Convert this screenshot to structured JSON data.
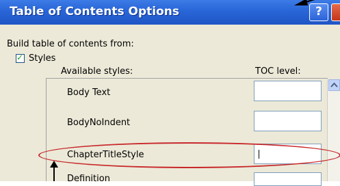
{
  "dialog": {
    "title": "Table of Contents Options",
    "help_glyph": "?"
  },
  "build": {
    "label": "Build table of contents from:",
    "styles_checkbox": {
      "label": "Styles",
      "checked": true,
      "check_glyph": "✓"
    }
  },
  "columns": {
    "available_styles": "Available styles:",
    "toc_level": "TOC level:"
  },
  "styles": [
    {
      "name": "Body Text",
      "level": ""
    },
    {
      "name": "BodyNoIndent",
      "level": ""
    },
    {
      "name": "ChapterTitleStyle",
      "level": ""
    },
    {
      "name": "Definition",
      "level": ""
    }
  ],
  "colors": {
    "titlebar": "#2a67d9",
    "dialog_bg": "#ece9d8",
    "highlight_ring": "#c8282b"
  }
}
